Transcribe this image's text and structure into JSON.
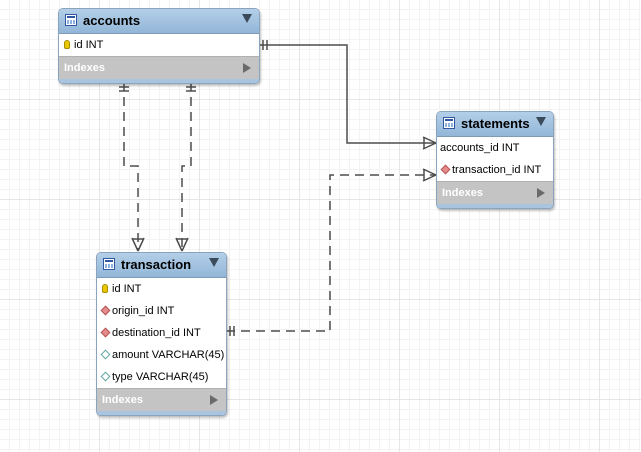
{
  "tables": {
    "accounts": {
      "name": "accounts",
      "columns": [
        {
          "label": "id INT",
          "key": "primary"
        }
      ],
      "indexes_label": "Indexes"
    },
    "statements": {
      "name": "statements",
      "columns": [
        {
          "label": "accounts_id INT",
          "key": "none"
        },
        {
          "label": "transaction_id INT",
          "key": "foreign"
        }
      ],
      "indexes_label": "Indexes"
    },
    "transaction": {
      "name": "transaction",
      "columns": [
        {
          "label": "id INT",
          "key": "primary"
        },
        {
          "label": "origin_id INT",
          "key": "foreign"
        },
        {
          "label": "destination_id INT",
          "key": "foreign"
        },
        {
          "label": "amount VARCHAR(45)",
          "key": "attribute"
        },
        {
          "label": "type VARCHAR(45)",
          "key": "attribute"
        }
      ],
      "indexes_label": "Indexes"
    }
  },
  "relationships": [
    {
      "from": "accounts",
      "to": "statements",
      "style": "identifying",
      "from_card": "one",
      "to_card": "many"
    },
    {
      "from": "accounts",
      "to": "transaction",
      "style": "non-identifying",
      "from_card": "one",
      "to_card": "many"
    },
    {
      "from": "accounts",
      "to": "transaction",
      "style": "non-identifying",
      "from_card": "one",
      "to_card": "many"
    },
    {
      "from": "transaction",
      "to": "statements",
      "style": "non-identifying",
      "from_card": "one",
      "to_card": "many"
    }
  ]
}
